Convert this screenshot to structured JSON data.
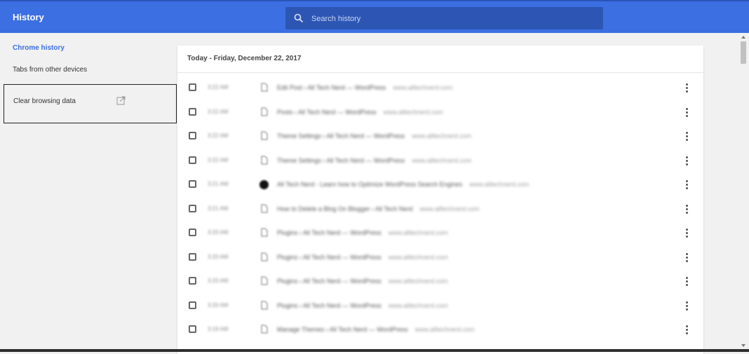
{
  "app": {
    "title": "History"
  },
  "search": {
    "placeholder": "Search history"
  },
  "sidebar": {
    "items": [
      {
        "label": "Chrome history",
        "active": true
      },
      {
        "label": "Tabs from other devices",
        "active": false
      }
    ],
    "clear_label": "Clear browsing data"
  },
  "history": {
    "date_header": "Today - Friday, December 22, 2017",
    "entries": [
      {
        "time": "3:22 AM",
        "title": "Edit Post ‹ All Tech Nerd — WordPress",
        "domain": "www.alltechnerd.com",
        "icon": "page-icon"
      },
      {
        "time": "3:22 AM",
        "title": "Posts ‹ All Tech Nerd — WordPress",
        "domain": "www.alltechnerd.com",
        "icon": "page-icon"
      },
      {
        "time": "3:22 AM",
        "title": "Theme Settings ‹ All Tech Nerd — WordPress",
        "domain": "www.alltechnerd.com",
        "icon": "page-icon"
      },
      {
        "time": "3:22 AM",
        "title": "Theme Settings ‹ All Tech Nerd — WordPress",
        "domain": "www.alltechnerd.com",
        "icon": "page-icon"
      },
      {
        "time": "3:21 AM",
        "title": "All Tech Nerd - Learn how to Optimize WordPress Search Engines",
        "domain": "www.alltechnerd.com",
        "icon": "site-icon"
      },
      {
        "time": "3:21 AM",
        "title": "How to Delete a Blog On Blogger ‹ All Tech Nerd",
        "domain": "www.alltechnerd.com",
        "icon": "page-icon"
      },
      {
        "time": "3:20 AM",
        "title": "Plugins ‹ All Tech Nerd — WordPress",
        "domain": "www.alltechnerd.com",
        "icon": "page-icon"
      },
      {
        "time": "3:20 AM",
        "title": "Plugins ‹ All Tech Nerd — WordPress",
        "domain": "www.alltechnerd.com",
        "icon": "page-icon"
      },
      {
        "time": "3:20 AM",
        "title": "Plugins ‹ All Tech Nerd — WordPress",
        "domain": "www.alltechnerd.com",
        "icon": "page-icon"
      },
      {
        "time": "3:20 AM",
        "title": "Plugins ‹ All Tech Nerd — WordPress",
        "domain": "www.alltechnerd.com",
        "icon": "page-icon"
      },
      {
        "time": "3:19 AM",
        "title": "Manage Themes ‹ All Tech Nerd — WordPress",
        "domain": "www.alltechnerd.com",
        "icon": "page-icon"
      }
    ]
  },
  "colors": {
    "accent": "#3b6fe2",
    "search_bg": "#2d56b4"
  }
}
